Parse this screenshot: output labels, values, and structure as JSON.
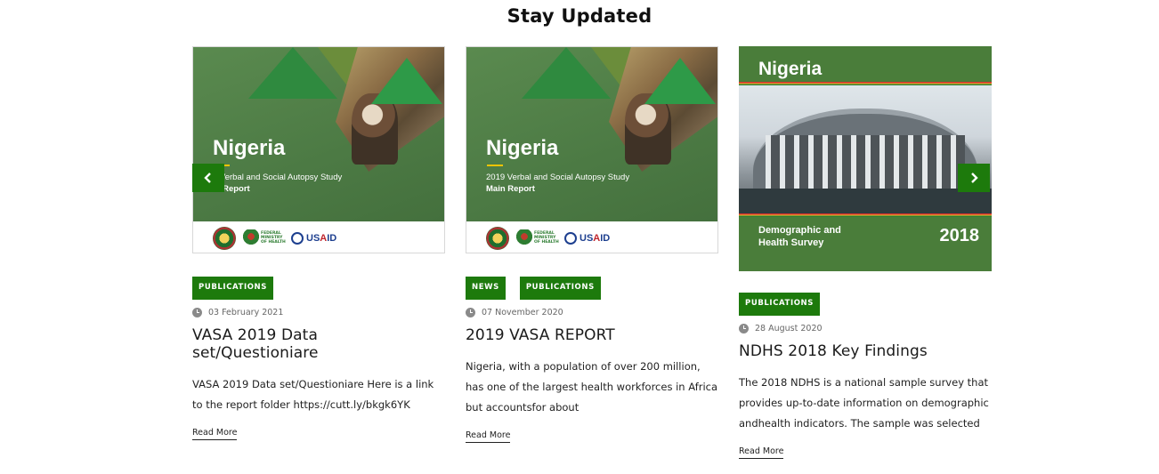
{
  "section": {
    "title": "Stay Updated"
  },
  "carousel": {
    "prev_icon": "chevron-left-icon",
    "next_icon": "chevron-right-icon",
    "accent": "#1d7a0c"
  },
  "cards": [
    {
      "cover": {
        "country": "Nigeria",
        "subtitle": "9 Verbal and Social Autopsy Study",
        "subtitle2": "in Report",
        "partner_logo": "USAID"
      },
      "tags": [
        "PUBLICATIONS"
      ],
      "date": "03 February 2021",
      "title": "VASA 2019 Data set/Questioniare",
      "excerpt": "VASA 2019 Data set/Questioniare Here is a link to the report folder https://cutt.ly/bkgk6YK",
      "read_more": "Read More"
    },
    {
      "cover": {
        "country": "Nigeria",
        "subtitle": "2019 Verbal and Social Autopsy Study",
        "subtitle2": "Main Report",
        "partner_logo": "USAID"
      },
      "tags": [
        "NEWS",
        "PUBLICATIONS"
      ],
      "date": "07 November 2020",
      "title": "2019 VASA REPORT",
      "excerpt": "Nigeria, with a population of over 200 million, has one of the largest health workforces in Africa but accountsfor about",
      "read_more": "Read More"
    },
    {
      "cover": {
        "country": "Nigeria",
        "subtitle": "Demographic and Health Survey",
        "year": "2018"
      },
      "tags": [
        "PUBLICATIONS"
      ],
      "date": "28 August 2020",
      "title": "NDHS 2018 Key Findings",
      "excerpt": "The 2018 NDHS is a national sample survey that provides up-to-date information on demographic andhealth indicators. The sample was selected",
      "read_more": "Read More"
    }
  ]
}
